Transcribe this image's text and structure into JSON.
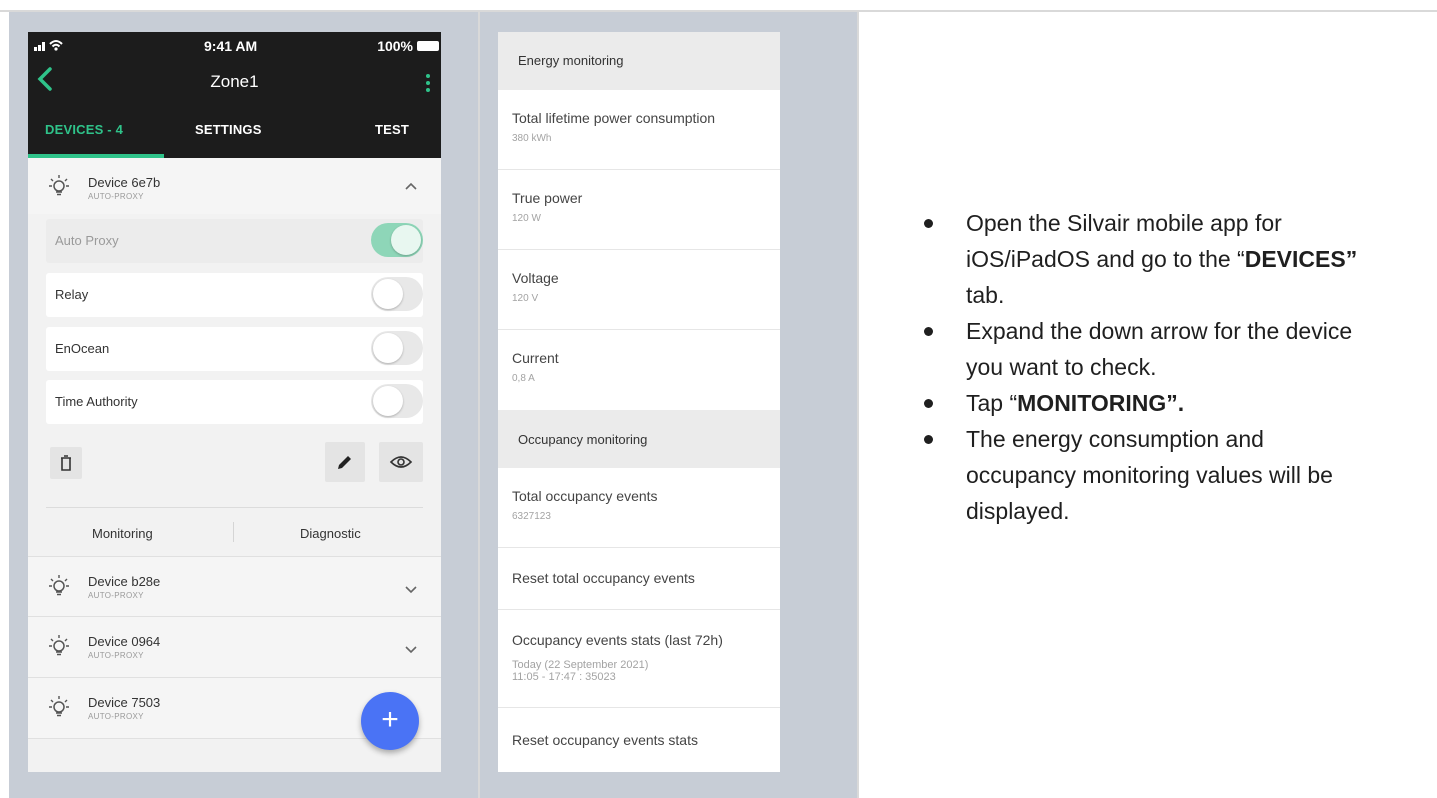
{
  "phone1": {
    "status_time": "9:41 AM",
    "status_battery": "100%",
    "title": "Zone1",
    "tabs": [
      {
        "label": "DEVICES - 4",
        "active": true
      },
      {
        "label": "SETTINGS",
        "active": false
      },
      {
        "label": "TEST",
        "active": false
      }
    ],
    "devices": [
      {
        "name": "Device 6e7b",
        "sub": "AUTO-PROXY",
        "chevron": "chevron-up-icon"
      },
      {
        "name": "Device b28e",
        "sub": "AUTO-PROXY",
        "chevron": "chevron-down-icon"
      },
      {
        "name": "Device 0964",
        "sub": "AUTO-PROXY",
        "chevron": "chevron-down-icon"
      },
      {
        "name": "Device 7503",
        "sub": "AUTO-PROXY",
        "chevron": ""
      }
    ],
    "options": [
      {
        "label": "Auto Proxy",
        "on": true,
        "disabled": true
      },
      {
        "label": "Relay",
        "on": false,
        "disabled": false
      },
      {
        "label": "EnOcean",
        "on": false,
        "disabled": false
      },
      {
        "label": "Time Authority",
        "on": false,
        "disabled": false
      }
    ],
    "monitoring_label": "Monitoring",
    "diagnostic_label": "Diagnostic",
    "fab_label": "+",
    "accent_color": "#2fc38a",
    "fab_color": "#4a73f5"
  },
  "phone2": {
    "energy_header": "Energy monitoring",
    "energy_rows": [
      {
        "title": "Total lifetime power consumption",
        "value": "380 kWh"
      },
      {
        "title": "True power",
        "value": "120 W"
      },
      {
        "title": "Voltage",
        "value": "120 V"
      },
      {
        "title": "Current",
        "value": "0,8 A"
      }
    ],
    "occupancy_header": "Occupancy monitoring",
    "occupancy_rows": [
      {
        "title": "Total occupancy events",
        "value": "6327123"
      },
      {
        "title": "Reset total occupancy events",
        "value": ""
      },
      {
        "title": "Occupancy events stats (last 72h)",
        "value": "Today (22 September 2021)",
        "value2": "11:05 - 17:47 : 35023"
      },
      {
        "title": "Reset occupancy events stats",
        "value": ""
      }
    ]
  },
  "instructions": {
    "b1_pre": "Open the Silvair mobile app for iOS/iPadOS and go to the “",
    "b1_bold": "DEVICES”",
    "b1_post": " tab.",
    "b2": "Expand the down arrow for the device you want to check.",
    "b3_pre": "Tap “",
    "b3_bold": "MONITORING”.",
    "b4": "The energy consumption and occupancy monitoring values will be displayed."
  }
}
